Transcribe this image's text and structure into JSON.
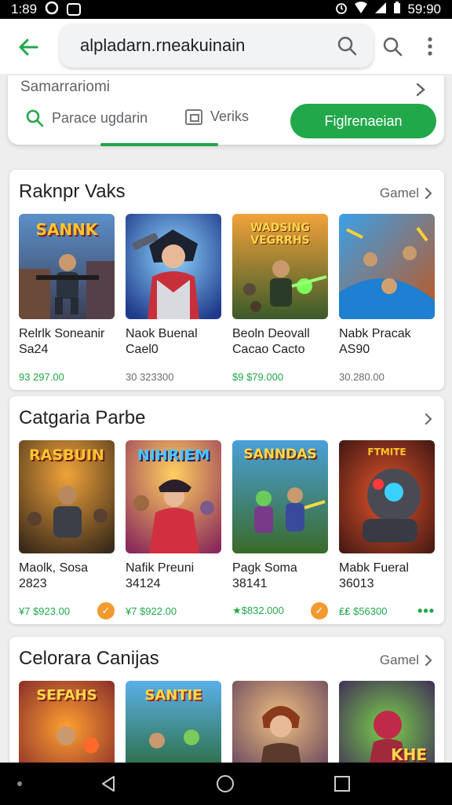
{
  "status_bar": {
    "left_time": "1:89",
    "right_time": "59:90"
  },
  "search": {
    "query": "alpladarn.rneakuinain"
  },
  "filter": {
    "title": "Samarrariomi",
    "chip_search_label": "Parace ugdarin",
    "chip_verify_label": "Veriks",
    "primary_button_label": "Figlrenaeian"
  },
  "sections": [
    {
      "title": "Raknpr Vaks",
      "more_label": "Gamel",
      "items": [
        {
          "art_text": "SANNK",
          "title": "Relrlk Soneanir",
          "subtitle": "Sa24",
          "price": "93 297.00",
          "price_style": "green"
        },
        {
          "art_text": "",
          "title": "Naok Buenal",
          "subtitle": "Cael0",
          "price": "30 323300",
          "price_style": "grey"
        },
        {
          "art_text": "WADSING VEGRRHS",
          "title": "Beoln Deovall",
          "subtitle": "Cacao Cacto",
          "price": "$9 $79.000",
          "price_style": "green"
        },
        {
          "art_text": "",
          "title": "Nabk Pracak",
          "subtitle": "AS90",
          "price": "30.280.00",
          "price_style": "grey"
        }
      ]
    },
    {
      "title": "Catgaria Parbe",
      "more_label": "",
      "items": [
        {
          "art_text": "RASBUIN",
          "title": "Maolk, Sosa",
          "subtitle": "2823",
          "price": "¥7 $923.00",
          "price_style": "green",
          "badge": "✓"
        },
        {
          "art_text": "NIHRIEM",
          "title": "Nafik Preuni",
          "subtitle": "34124",
          "price": "¥7 $922.00",
          "price_style": "green"
        },
        {
          "art_text": "SANNDAS",
          "title": "Pagk Soma",
          "subtitle": "38141",
          "price": "★$832.000",
          "price_style": "green",
          "badge": "✓"
        },
        {
          "art_text": "FTMITE",
          "title": "Mabk Fueral",
          "subtitle": "36013",
          "price": "₤₤ $56300",
          "price_style": "green",
          "dots": "•••"
        }
      ]
    },
    {
      "title": "Celorara Canijas",
      "more_label": "Gamel",
      "items": [
        {
          "art_text": "SEFAHS"
        },
        {
          "art_text": "SANTIE"
        },
        {
          "art_text": ""
        },
        {
          "art_text": "KHE"
        }
      ]
    }
  ],
  "colors": {
    "accent_green": "#21a84a",
    "badge_orange": "#f29a2e"
  },
  "icons": {
    "back": "arrow-left-icon",
    "search": "magnifier-icon",
    "more": "vertical-dots-icon",
    "chevron": "chevron-right-icon",
    "verify": "frame-icon"
  }
}
